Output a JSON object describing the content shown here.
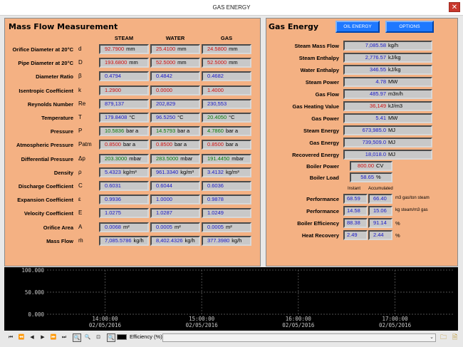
{
  "window": {
    "title": "GAS ENERGY",
    "close": "✕"
  },
  "mass_flow": {
    "title": "Mass Flow Measurement",
    "columns": [
      "STEAM",
      "WATER",
      "GAS"
    ],
    "rows": [
      {
        "label": "Orifice Diameter at 20°C",
        "sym": "d",
        "cells": [
          {
            "v": "92.7900",
            "u": "mm",
            "c": "red"
          },
          {
            "v": "25.4100",
            "u": "mm",
            "c": "red"
          },
          {
            "v": "24.5800",
            "u": "mm",
            "c": "red"
          }
        ]
      },
      {
        "label": "Pipe Diameter at 20°C",
        "sym": "D",
        "cells": [
          {
            "v": "193.6800",
            "u": "mm",
            "c": "red"
          },
          {
            "v": "52.5000",
            "u": "mm",
            "c": "red"
          },
          {
            "v": "52.5000",
            "u": "mm",
            "c": "red"
          }
        ]
      },
      {
        "label": "Diameter Ratio",
        "sym": "β",
        "cells": [
          {
            "v": "0.4794",
            "u": "",
            "c": "blue"
          },
          {
            "v": "0.4842",
            "u": "",
            "c": "blue"
          },
          {
            "v": "0.4682",
            "u": "",
            "c": "blue"
          }
        ]
      },
      {
        "label": "Isentropic Coefficient",
        "sym": "k",
        "cells": [
          {
            "v": "1.2900",
            "u": "",
            "c": "red"
          },
          {
            "v": "0.0000",
            "u": "",
            "c": "red"
          },
          {
            "v": "1.4000",
            "u": "",
            "c": "red"
          }
        ]
      },
      {
        "label": "Reynolds Number",
        "sym": "Re",
        "cells": [
          {
            "v": "879,137",
            "u": "",
            "c": "blue"
          },
          {
            "v": "202,829",
            "u": "",
            "c": "blue"
          },
          {
            "v": "230,553",
            "u": "",
            "c": "blue"
          }
        ]
      },
      {
        "label": "Temperature",
        "sym": "T",
        "cells": [
          {
            "v": "179.8408",
            "u": "°C",
            "c": "blue"
          },
          {
            "v": "96.5250",
            "u": "°C",
            "c": "blue"
          },
          {
            "v": "20.4050",
            "u": "°C",
            "c": "green"
          }
        ]
      },
      {
        "label": "Pressure",
        "sym": "P",
        "cells": [
          {
            "v": "10.5836",
            "u": "bar a",
            "c": "green"
          },
          {
            "v": "14.5793",
            "u": "bar a",
            "c": "green"
          },
          {
            "v": "4.7860",
            "u": "bar a",
            "c": "green"
          }
        ]
      },
      {
        "label": "Atmospheric Pressure",
        "sym": "Patm",
        "cells": [
          {
            "v": "0.8500",
            "u": "bar a",
            "c": "red"
          },
          {
            "v": "0.8500",
            "u": "bar a",
            "c": "red"
          },
          {
            "v": "0.8500",
            "u": "bar a",
            "c": "red"
          }
        ]
      },
      {
        "label": "Differential Pressure",
        "sym": "Δp",
        "cells": [
          {
            "v": "203.3000",
            "u": "mbar",
            "c": "green"
          },
          {
            "v": "283.5000",
            "u": "mbar",
            "c": "green"
          },
          {
            "v": "191.4450",
            "u": "mbar",
            "c": "green"
          }
        ]
      },
      {
        "label": "Density",
        "sym": "ρ",
        "cells": [
          {
            "v": "5.4323",
            "u": "kg/m³",
            "c": "blue"
          },
          {
            "v": "961.3340",
            "u": "kg/m³",
            "c": "blue"
          },
          {
            "v": "3.4132",
            "u": "kg/m³",
            "c": "blue"
          }
        ]
      },
      {
        "label": "Discharge Coefficient",
        "sym": "C",
        "cells": [
          {
            "v": "0.6031",
            "u": "",
            "c": "blue"
          },
          {
            "v": "0.6044",
            "u": "",
            "c": "blue"
          },
          {
            "v": "0.6036",
            "u": "",
            "c": "blue"
          }
        ]
      },
      {
        "label": "Expansion Coefficient",
        "sym": "ε",
        "cells": [
          {
            "v": "0.9936",
            "u": "",
            "c": "blue"
          },
          {
            "v": "1.0000",
            "u": "",
            "c": "blue"
          },
          {
            "v": "0.9878",
            "u": "",
            "c": "blue"
          }
        ]
      },
      {
        "label": "Velocity Coefficient",
        "sym": "E",
        "cells": [
          {
            "v": "1.0275",
            "u": "",
            "c": "blue"
          },
          {
            "v": "1.0287",
            "u": "",
            "c": "blue"
          },
          {
            "v": "1.0249",
            "u": "",
            "c": "blue"
          }
        ]
      },
      {
        "label": "Orifice Area",
        "sym": "A",
        "cells": [
          {
            "v": "0.0068",
            "u": "m²",
            "c": "blue"
          },
          {
            "v": "0.0005",
            "u": "m²",
            "c": "blue"
          },
          {
            "v": "0.0005",
            "u": "m²",
            "c": "blue"
          }
        ]
      },
      {
        "label": "Mass Flow",
        "sym": "ṁ",
        "cells": [
          {
            "v": "7,085.5786",
            "u": "kg/h",
            "c": "blue"
          },
          {
            "v": "8,402.4326",
            "u": "kg/h",
            "c": "blue"
          },
          {
            "v": "377.3980",
            "u": "kg/h",
            "c": "blue"
          }
        ]
      }
    ]
  },
  "gas_energy": {
    "title": "Gas Energy",
    "buttons": {
      "oil": "OIL ENERGY",
      "options": "OPTIONS"
    },
    "rows": [
      {
        "label": "Steam Mass Flow",
        "v": "7,085.58",
        "u": "kg/h",
        "c": "blue"
      },
      {
        "label": "Steam Enthalpy",
        "v": "2,776.57",
        "u": "kJ/kg",
        "c": "blue"
      },
      {
        "label": "Water Enthalpy",
        "v": "346.55",
        "u": "kJ/kg",
        "c": "blue"
      },
      {
        "label": "Steam Power",
        "v": "4.78",
        "u": "MW",
        "c": "blue"
      },
      {
        "label": "Gas Flow",
        "v": "485.97",
        "u": "m3n/h",
        "c": "blue"
      },
      {
        "label": "Gas Heating Value",
        "v": "36,149",
        "u": "kJ/m3",
        "c": "red"
      },
      {
        "label": "Gas Power",
        "v": "5.41",
        "u": "MW",
        "c": "blue"
      },
      {
        "label": "Steam Energy",
        "v": "673,985.0",
        "u": "MJ",
        "c": "blue"
      },
      {
        "label": "Gas Energy",
        "v": "739,509.0",
        "u": "MJ",
        "c": "blue"
      },
      {
        "label": "Recovered Energy",
        "v": "18,018.0",
        "u": "MJ",
        "c": "blue"
      }
    ],
    "boiler_power": {
      "label": "Boiler Power",
      "v": "800.00",
      "u": "CV",
      "c": "red"
    },
    "boiler_load": {
      "label": "Boiler Load",
      "v": "58.65",
      "u": "%",
      "c": "blue"
    },
    "perf_headers": {
      "instant": "Instant",
      "accumulated": "Accumulated"
    },
    "perf_rows": [
      {
        "label": "Performance",
        "a": "68.59",
        "b": "66.40",
        "u": "m3 gas/ton steam"
      },
      {
        "label": "Performance",
        "a": "14.58",
        "b": "15.06",
        "u": "kg steam/m3 gas"
      },
      {
        "label": "Boiler Efficiency",
        "a": "88.38",
        "b": "91.14",
        "u": "%"
      },
      {
        "label": "Heat Recovery",
        "a": "2.49",
        "b": "2.44",
        "u": "%"
      }
    ]
  },
  "chart_data": {
    "type": "line",
    "y_ticks": [
      "100.000",
      "50.000",
      "0.000"
    ],
    "ylim": [
      0,
      100
    ],
    "x_ticks": [
      {
        "time": "14:00:00",
        "date": "02/05/2016"
      },
      {
        "time": "15:00:00",
        "date": "02/05/2016"
      },
      {
        "time": "16:00:00",
        "date": "02/05/2016"
      },
      {
        "time": "17:00:00",
        "date": "02/05/2016"
      }
    ],
    "series": [
      {
        "name": "Efficiency (%)",
        "values": []
      }
    ],
    "grid": true,
    "colors": {
      "background": "#000000",
      "grid": "#6a6a6a",
      "text": "#c8c8c8"
    }
  },
  "toolbar": {
    "nav": [
      "⏮",
      "⏪",
      "◀",
      "▶",
      "⏩",
      "⏭"
    ],
    "legend_label": "Efficiency (%)"
  }
}
